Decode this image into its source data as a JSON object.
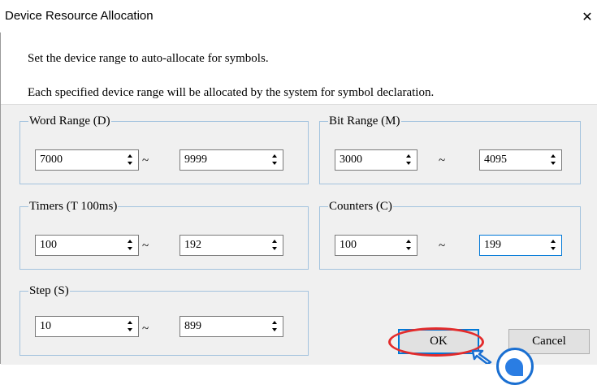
{
  "window": {
    "title": "Device Resource Allocation",
    "close_glyph": "✕"
  },
  "messages": {
    "line1": "Set the device range to auto-allocate for symbols.",
    "line2": "Each specified device range will be allocated by the system for symbol declaration."
  },
  "groups": {
    "word": {
      "label": "Word Range (D)",
      "from": "7000",
      "to": "9999"
    },
    "bit": {
      "label": "Bit Range (M)",
      "from": "3000",
      "to": "4095"
    },
    "timers": {
      "label": "Timers (T 100ms)",
      "from": "100",
      "to": "192"
    },
    "counters": {
      "label": "Counters (C)",
      "from": "100",
      "to": "199"
    },
    "step": {
      "label": "Step (S)",
      "from": "10",
      "to": "899"
    }
  },
  "range_separator": "~",
  "buttons": {
    "ok": "OK",
    "cancel": "Cancel"
  },
  "colors": {
    "group_border": "#a3c3de",
    "focus_border": "#0078d7",
    "annotation_red": "#e32b2b",
    "cursor_blue": "#1a6fd1"
  },
  "icons": {
    "close": "close-icon",
    "spin_up": "arrow-up-icon",
    "spin_down": "arrow-down-icon",
    "cursor": "mouse-cursor-icon"
  }
}
